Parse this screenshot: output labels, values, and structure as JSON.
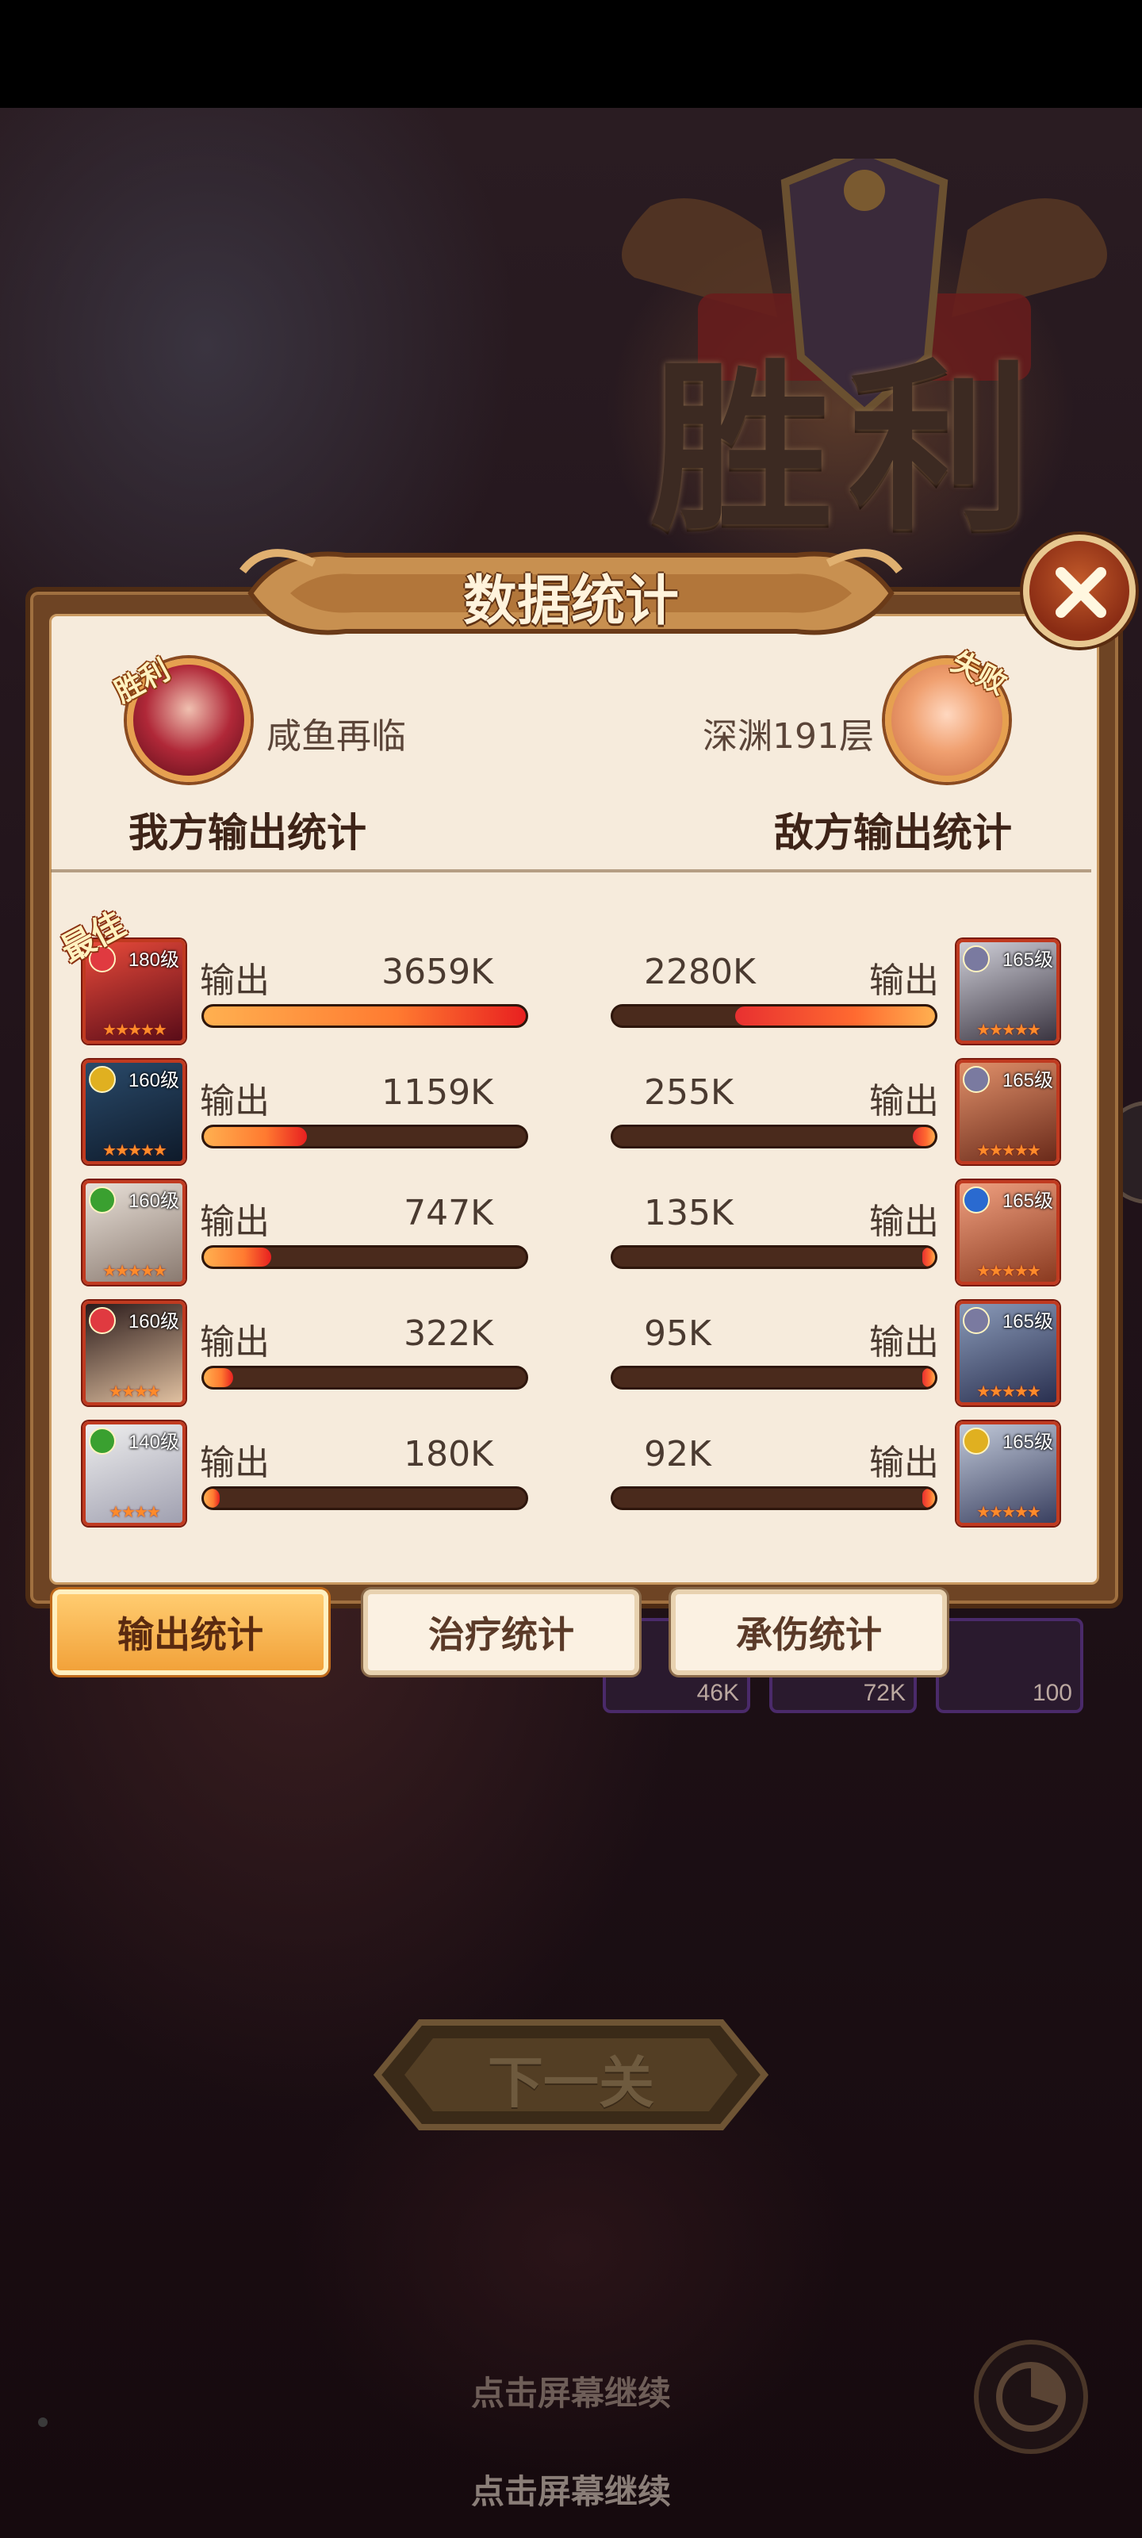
{
  "background": {
    "victory_title": "胜利",
    "enemy_team_preview": [
      {
        "value": "46K"
      },
      {
        "value": "72K"
      },
      {
        "value": "100"
      }
    ]
  },
  "panel": {
    "title": "数据统计",
    "our_side": {
      "result_tag": "胜利",
      "player_name": "咸鱼再临",
      "section_title": "我方输出统计"
    },
    "enemy_side": {
      "result_tag": "失败",
      "player_name": "深渊191层",
      "section_title": "敌方输出统计"
    },
    "best_badge": "最佳",
    "rows": [
      {
        "ally": {
          "level": "180级",
          "label": "输出",
          "value": "3659K",
          "fill": 1.0,
          "faction_color": "#e03a40",
          "stars": "★★★★★"
        },
        "enemy": {
          "level": "165级",
          "label": "输出",
          "value": "2280K",
          "fill": 0.62,
          "faction_color": "#7a7aa0",
          "stars": "★★★★★"
        }
      },
      {
        "ally": {
          "level": "160级",
          "label": "输出",
          "value": "1159K",
          "fill": 0.32,
          "faction_color": "#e0b020",
          "stars": "★★★★★"
        },
        "enemy": {
          "level": "165级",
          "label": "输出",
          "value": "255K",
          "fill": 0.07,
          "faction_color": "#7a7aa0",
          "stars": "★★★★★"
        }
      },
      {
        "ally": {
          "level": "160级",
          "label": "输出",
          "value": "747K",
          "fill": 0.21,
          "faction_color": "#3aa030",
          "stars": "★★★★★"
        },
        "enemy": {
          "level": "165级",
          "label": "输出",
          "value": "135K",
          "fill": 0.04,
          "faction_color": "#2a6ad0",
          "stars": "★★★★★"
        }
      },
      {
        "ally": {
          "level": "160级",
          "label": "输出",
          "value": "322K",
          "fill": 0.09,
          "faction_color": "#e03a40",
          "stars": "★★★★"
        },
        "enemy": {
          "level": "165级",
          "label": "输出",
          "value": "95K",
          "fill": 0.03,
          "faction_color": "#7a7aa0",
          "stars": "★★★★★"
        }
      },
      {
        "ally": {
          "level": "140级",
          "label": "输出",
          "value": "180K",
          "fill": 0.05,
          "faction_color": "#3aa030",
          "stars": "★★★★"
        },
        "enemy": {
          "level": "165级",
          "label": "输出",
          "value": "92K",
          "fill": 0.03,
          "faction_color": "#e0b020",
          "stars": "★★★★★"
        }
      }
    ]
  },
  "tabs": [
    {
      "label": "输出统计",
      "active": true
    },
    {
      "label": "治疗统计",
      "active": false
    },
    {
      "label": "承伤统计",
      "active": false
    }
  ],
  "next_button": {
    "label": "下一关"
  },
  "continue_hints": [
    "点击屏幕继续",
    "点击屏幕继续"
  ],
  "icons": {
    "close": "close-icon",
    "stats": "pie-chart-icon"
  },
  "colors": {
    "panel_bg": "#f6ebdc",
    "bar_fill": "#ff7a30",
    "bar_track": "#4a2a1c",
    "active_tab": "#f2a23a"
  }
}
